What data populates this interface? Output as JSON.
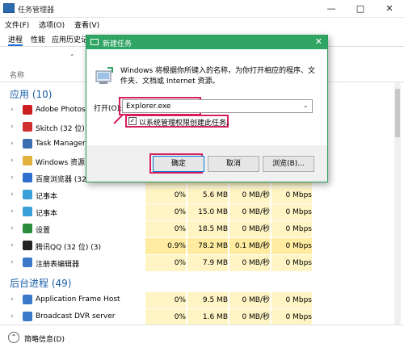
{
  "window": {
    "title": "任务管理器",
    "minimize": "—",
    "maximize": "□",
    "close": "✕"
  },
  "menu": [
    "文件(F)",
    "选项(O)",
    "查看(V)"
  ],
  "tabs": [
    "进程",
    "性能",
    "应用历史记"
  ],
  "columns": {
    "name_header": "名称"
  },
  "groups": {
    "apps": "应用 (10)",
    "background": "后台进程 (49)"
  },
  "rows": [
    {
      "name": "Adobe Photos",
      "icon_color": "#cc2020",
      "cells": [
        "",
        "",
        "",
        ""
      ]
    },
    {
      "name": "Skitch (32 位)",
      "icon_color": "#d03030",
      "cells": [
        "",
        "",
        "",
        ""
      ]
    },
    {
      "name": "Task Manager",
      "icon_color": "#3a6fb0",
      "cells": [
        "",
        "",
        "",
        ""
      ]
    },
    {
      "name": "Windows 资源",
      "icon_color": "#e3b23c",
      "cells": [
        "",
        "",
        "",
        ""
      ]
    },
    {
      "name": "百度浏览器 (32",
      "icon_color": "#2f6fd0",
      "cells": [
        "",
        "",
        "",
        ""
      ]
    },
    {
      "name": "记事本",
      "icon_color": "#3aa0d8",
      "cells": [
        "0%",
        "5.6 MB",
        "0 MB/秒",
        "0 Mbps"
      ]
    },
    {
      "name": "记事本",
      "icon_color": "#3aa0d8",
      "cells": [
        "0%",
        "15.0 MB",
        "0 MB/秒",
        "0 Mbps"
      ]
    },
    {
      "name": "设置",
      "icon_color": "#2a8c3c",
      "cells": [
        "0%",
        "18.5 MB",
        "0 MB/秒",
        "0 Mbps"
      ]
    },
    {
      "name": "腾讯QQ (32 位) (3)",
      "icon_color": "#222222",
      "cells": [
        "0.9%",
        "78.2 MB",
        "0.1 MB/秒",
        "0 Mbps"
      ]
    },
    {
      "name": "注册表编辑器",
      "icon_color": "#3a78c8",
      "cells": [
        "0%",
        "7.9 MB",
        "0 MB/秒",
        "0 Mbps"
      ]
    }
  ],
  "bg_rows": [
    {
      "name": "Application Frame Host",
      "icon_color": "#3a78c8",
      "cells": [
        "0%",
        "9.5 MB",
        "0 MB/秒",
        "0 Mbps"
      ]
    },
    {
      "name": "Broadcast DVR server",
      "icon_color": "#3a78c8",
      "cells": [
        "0%",
        "1.6 MB",
        "0 MB/秒",
        "0 Mbps"
      ]
    }
  ],
  "footer": {
    "summary_label": "简略信息(D)"
  },
  "dialog": {
    "title": "新建任务",
    "close": "✕",
    "description": "Windows 将根据你所键入的名称，为你打开相应的程序、文件夹、文档或 Internet 资源。",
    "open_label": "打开(O):",
    "open_value": "Explorer.exe",
    "admin_label": "以系统管理权限创建此任务。",
    "admin_checked": "✓",
    "ok": "确定",
    "cancel": "取消",
    "browse": "浏览(B)..."
  },
  "colors": {
    "accent": "#2fa463",
    "highlight": "#d61e5b"
  }
}
